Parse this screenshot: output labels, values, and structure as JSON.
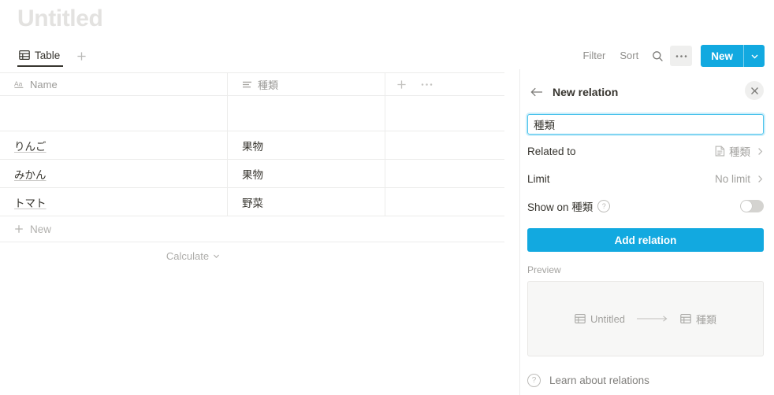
{
  "page": {
    "title": "Untitled"
  },
  "view_tabs": {
    "tabs": [
      {
        "label": "Table",
        "icon": "table-icon",
        "active": true
      }
    ],
    "add_label": "+"
  },
  "toolbar": {
    "filter_label": "Filter",
    "sort_label": "Sort",
    "search_icon": "search-icon",
    "more_icon": "ellipsis-icon",
    "new_label": "New",
    "new_caret_icon": "chevron-down-icon",
    "accent_color": "#12a9e0"
  },
  "table": {
    "columns": [
      {
        "name": "Name",
        "icon": "title-text-icon"
      },
      {
        "name": "種類",
        "icon": "text-lines-icon"
      }
    ],
    "header_actions": {
      "add_column_icon": "plus-icon",
      "more_icon": "ellipsis-icon"
    },
    "rows": [
      {
        "name": "",
        "kind": ""
      },
      {
        "name": "りんご",
        "kind": "果物"
      },
      {
        "name": "みかん",
        "kind": "果物"
      },
      {
        "name": "トマト",
        "kind": "野菜"
      }
    ],
    "new_row_label": "New",
    "new_row_icon": "plus-icon",
    "calculate_label": "Calculate",
    "calculate_caret_icon": "chevron-down-icon"
  },
  "panel": {
    "back_icon": "arrow-left-icon",
    "title": "New relation",
    "close_icon": "close-icon",
    "name_input": {
      "value": "種類",
      "placeholder": ""
    },
    "related_to": {
      "label": "Related to",
      "value": "種類",
      "icon": "page-icon",
      "chevron_icon": "chevron-right-icon"
    },
    "limit": {
      "label": "Limit",
      "value": "No limit",
      "chevron_icon": "chevron-right-icon"
    },
    "show_on": {
      "label": "Show on 種類",
      "help_icon": "question-circle-icon",
      "toggle_on": false
    },
    "add_relation_label": "Add relation",
    "preview": {
      "label": "Preview",
      "source": {
        "label": "Untitled",
        "icon": "table-icon"
      },
      "arrow_icon": "arrow-right-icon",
      "target": {
        "label": "種類",
        "icon": "table-icon"
      }
    },
    "learn": {
      "label": "Learn about relations",
      "icon": "question-circle-icon"
    }
  }
}
